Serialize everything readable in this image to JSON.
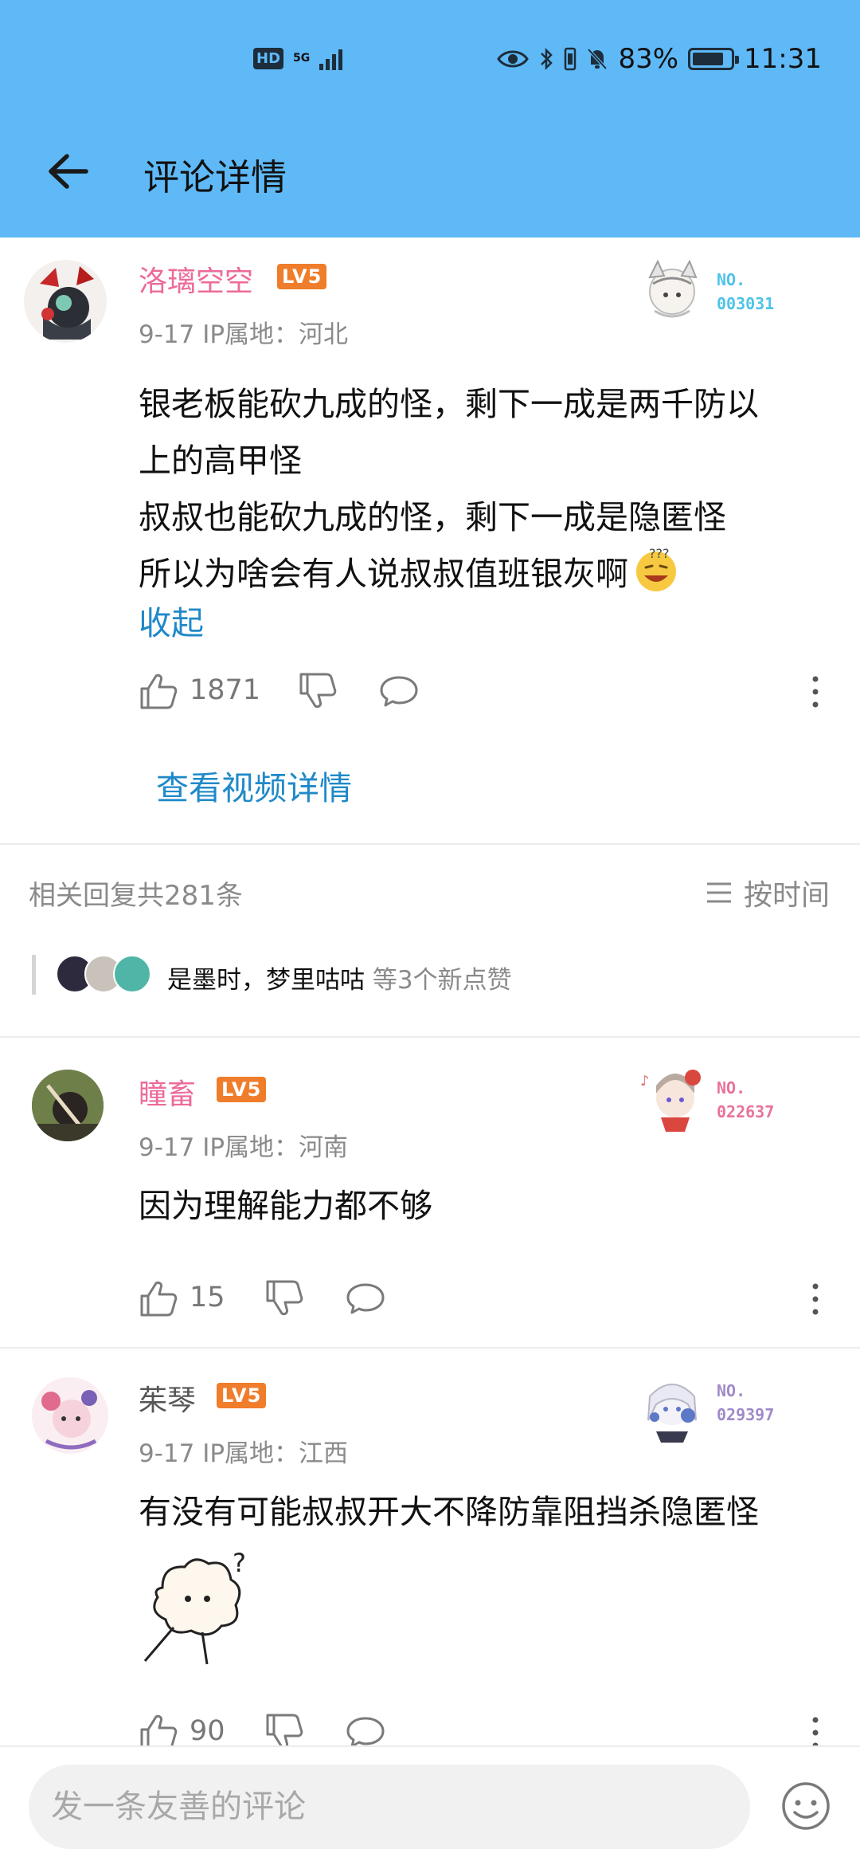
{
  "status_bar": {
    "hd": "HD",
    "network": "5G",
    "battery_pct_text": "83%",
    "battery_level": 0.83,
    "time": "11:31"
  },
  "header": {
    "title": "评论详情"
  },
  "main_comment": {
    "username": "洛璃空空",
    "level": "LV5",
    "date": "9-17",
    "ip": "IP属地：河北",
    "lines": [
      "银老板能砍九成的怪，剩下一成是两千防以",
      "上的高甲怪",
      "叔叔也能砍九成的怪，剩下一成是隐匿怪",
      "所以为啥会有人说叔叔值班银灰啊"
    ],
    "collapse_label": "收起",
    "likes": "1871",
    "badge_no": "NO.",
    "badge_num": "003031",
    "badge_color": "#4fc3e8"
  },
  "view_video_label": "查看视频详情",
  "replies_header": {
    "total": "相关回复共281条",
    "sort_label": "按时间"
  },
  "likers": {
    "names": "是墨时，梦里咕咕",
    "extra": "等3个新点赞"
  },
  "replies": [
    {
      "username": "瞳畜",
      "name_color": "#ec6b9a",
      "level": "LV5",
      "date": "9-17",
      "ip": "IP属地：河南",
      "text": "因为理解能力都不够",
      "likes": "15",
      "badge_no": "NO.",
      "badge_num": "022637",
      "badge_color": "#e8739a"
    },
    {
      "username": "茱琴",
      "name_color": "#555555",
      "level": "LV5",
      "date": "9-17",
      "ip": "IP属地：江西",
      "text": "有没有可能叔叔开大不降防靠阻挡杀隐匿怪",
      "likes": "90",
      "badge_no": "NO.",
      "badge_num": "029397",
      "badge_color": "#a08ac8"
    }
  ],
  "input": {
    "placeholder": "发一条友善的评论"
  },
  "icons": {
    "back": "arrow-left-icon",
    "like": "thumbs-up-icon",
    "dislike": "thumbs-down-icon",
    "reply": "speech-bubble-icon",
    "more": "more-vertical-icon",
    "sort": "menu-lines-icon",
    "emoji": "smiley-icon"
  }
}
